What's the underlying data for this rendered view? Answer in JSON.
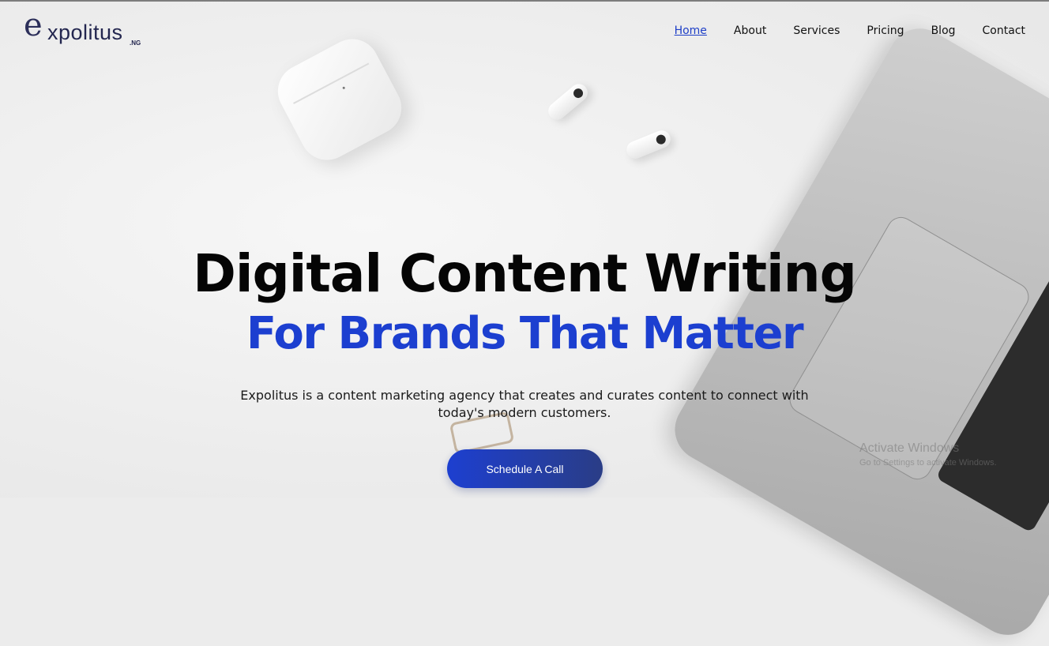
{
  "brand": {
    "logo_initial": "e",
    "logo_word": "xpolitus",
    "logo_tld": ".NG"
  },
  "nav": {
    "items": [
      {
        "label": "Home",
        "active": true
      },
      {
        "label": "About",
        "active": false
      },
      {
        "label": "Services",
        "active": false
      },
      {
        "label": "Pricing",
        "active": false
      },
      {
        "label": "Blog",
        "active": false
      },
      {
        "label": "Contact",
        "active": false
      }
    ]
  },
  "hero": {
    "title": "Digital Content Writing",
    "subtitle": "For Brands That Matter",
    "description": "Expolitus is a content marketing agency that creates and curates content to connect with today's modern customers.",
    "cta_label": "Schedule A Call"
  },
  "watermark": {
    "title": "Activate Windows",
    "subtitle": "Go to Settings to activate Windows."
  },
  "colors": {
    "accent": "#1c3fd0",
    "cta_gradient_start": "#1d3fd0",
    "cta_gradient_end": "#2a3d86",
    "headline": "#050505"
  }
}
